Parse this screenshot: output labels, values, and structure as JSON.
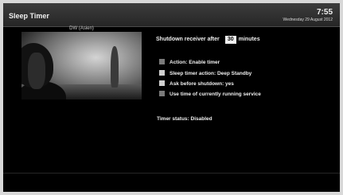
{
  "header": {
    "title": "Sleep Timer",
    "time": "7:55",
    "date": "Wednesday 29 August 2012"
  },
  "preview": {
    "channel": "DW (Asien)"
  },
  "settings": {
    "shutdown_label": "Shutdown receiver after",
    "minutes_value": "30",
    "minutes_unit": "minutes",
    "options": [
      {
        "label": "Action: Enable timer",
        "checked": false
      },
      {
        "label": "Sleep timer action: Deep Standby",
        "checked": true
      },
      {
        "label": "Ask before shutdown: yes",
        "checked": true
      },
      {
        "label": "Use time of currently running service",
        "checked": false
      }
    ]
  },
  "status": {
    "text": "Timer status: Disabled"
  }
}
